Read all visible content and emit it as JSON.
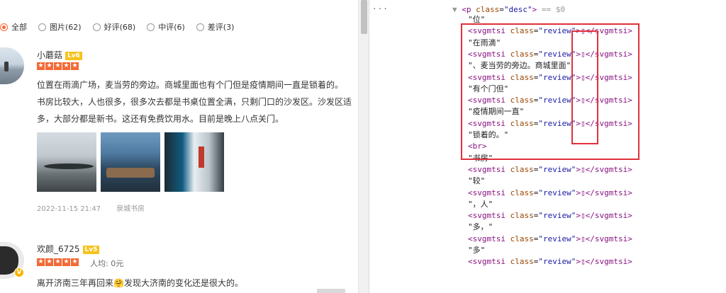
{
  "filters": [
    {
      "label": "全部",
      "count": "",
      "checked": true
    },
    {
      "label": "图片",
      "count": "(62)",
      "checked": false
    },
    {
      "label": "好评",
      "count": "(68)",
      "checked": false
    },
    {
      "label": "中评",
      "count": "(6)",
      "checked": false
    },
    {
      "label": "差评",
      "count": "(3)",
      "checked": false
    }
  ],
  "reviews": [
    {
      "user": "小蘑菇",
      "level": "Lv6",
      "lines": [
        "位置在雨滴广场，麦当劳的旁边。商城里面也有个门但是疫情期间一直是锁着的。",
        "书房比较大，人也很多，很多次去都是书桌位置全满，只剩门口的沙发区。沙发区适",
        "多，大部分都是新书。这还有免费饮用水。目前是晚上八点关门。"
      ],
      "date": "2022-11-15 21:47",
      "shop": "泉城书房"
    },
    {
      "user": "欢颜_6725",
      "level": "Lv5",
      "avg_label": "人均: 0元",
      "lines": [
        "离开济南三年再回来🤗发现大济南的变化还是很大的。"
      ]
    }
  ],
  "devtools": {
    "gutter": "···",
    "top_comment": "== $0",
    "p_tag_open": "<p",
    "p_attr": "class",
    "p_attr_val": "\"desc\"",
    "p_tag_close": ">",
    "svg_open": "<svgmtsi",
    "svg_attr": "class",
    "svg_val": "\"review\"",
    "svg_glyph": ">▯",
    "svg_close": "</svgmtsi>",
    "br": "<br>",
    "texts": [
      "\"位\"",
      "\"在雨滴\"",
      "\"、麦当劳的旁边。商城里面\"",
      "\"有个门但\"",
      "\"疫情期间一直\"",
      "\"锁着的。\"",
      "\"书房\"",
      "\"较\"",
      "\"，人\"",
      "\"多，\"",
      "\"多\""
    ]
  }
}
